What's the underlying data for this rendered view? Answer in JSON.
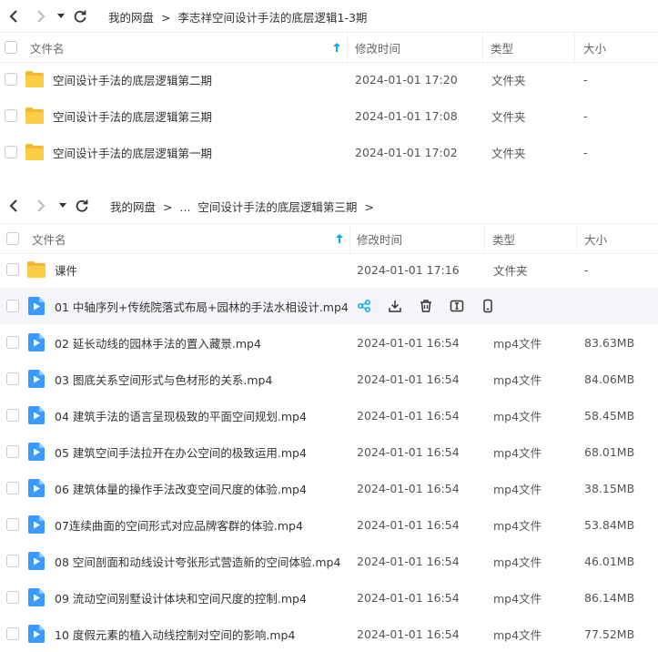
{
  "top": {
    "breadcrumb": [
      "我的网盘",
      "李志祥空间设计手法的底层逻辑1-3期"
    ],
    "headers": {
      "name": "文件名",
      "modified": "修改时间",
      "type": "类型",
      "size": "大小"
    },
    "rows": [
      {
        "name": "空间设计手法的底层逻辑第二期",
        "modified": "2024-01-01 17:20",
        "type": "文件夹",
        "size": "-",
        "icon": "folder-icon"
      },
      {
        "name": "空间设计手法的底层逻辑第三期",
        "modified": "2024-01-01 17:08",
        "type": "文件夹",
        "size": "-",
        "icon": "folder-icon"
      },
      {
        "name": "空间设计手法的底层逻辑第一期",
        "modified": "2024-01-01 17:02",
        "type": "文件夹",
        "size": "-",
        "icon": "folder-icon"
      }
    ]
  },
  "bottom": {
    "breadcrumb": [
      "我的网盘",
      "...",
      "空间设计手法的底层逻辑第三期"
    ],
    "headers": {
      "name": "文件名",
      "modified": "修改时间",
      "type": "类型",
      "size": "大小"
    },
    "rows": [
      {
        "name": "课件",
        "modified": "2024-01-01 17:16",
        "type": "文件夹",
        "size": "-",
        "icon": "folder-icon"
      },
      {
        "name": "01 中轴序列+传统院落式布局+园林的手法水相设计.mp4",
        "modified": "",
        "type": "",
        "size": "",
        "icon": "video-file-icon",
        "hovered": true
      },
      {
        "name": "02 延长动线的园林手法的置入藏景.mp4",
        "modified": "2024-01-01 16:54",
        "type": "mp4文件",
        "size": "83.63MB",
        "icon": "video-file-icon"
      },
      {
        "name": "03 图底关系空间形式与色材形的关系.mp4",
        "modified": "2024-01-01 16:54",
        "type": "mp4文件",
        "size": "84.06MB",
        "icon": "video-file-icon"
      },
      {
        "name": "04 建筑手法的语言呈现极致的平面空间规划.mp4",
        "modified": "2024-01-01 16:54",
        "type": "mp4文件",
        "size": "58.45MB",
        "icon": "video-file-icon"
      },
      {
        "name": "05 建筑空间手法拉开在办公空间的极致运用.mp4",
        "modified": "2024-01-01 16:54",
        "type": "mp4文件",
        "size": "68.01MB",
        "icon": "video-file-icon"
      },
      {
        "name": "06 建筑体量的操作手法改变空间尺度的体验.mp4",
        "modified": "2024-01-01 16:54",
        "type": "mp4文件",
        "size": "38.15MB",
        "icon": "video-file-icon"
      },
      {
        "name": "07连续曲面的空间形式对应品牌客群的体验.mp4",
        "modified": "2024-01-01 16:54",
        "type": "mp4文件",
        "size": "53.84MB",
        "icon": "video-file-icon"
      },
      {
        "name": "08 空间剖面和动线设计夸张形式营造新的空间体验.mp4",
        "modified": "2024-01-01 16:54",
        "type": "mp4文件",
        "size": "46.01MB",
        "icon": "video-file-icon"
      },
      {
        "name": "09 流动空间别墅设计体块和空间尺度的控制.mp4",
        "modified": "2024-01-01 16:54",
        "type": "mp4文件",
        "size": "86.14MB",
        "icon": "video-file-icon"
      },
      {
        "name": "10 度假元素的植入动线控制对空间的影响.mp4",
        "modified": "2024-01-01 16:54",
        "type": "mp4文件",
        "size": "77.52MB",
        "icon": "video-file-icon"
      }
    ],
    "row_actions": [
      "share-icon",
      "download-icon",
      "delete-icon",
      "rename-icon",
      "mobile-icon"
    ]
  },
  "colors": {
    "accent": "#06a7ff",
    "folder": "#f9c536",
    "video": "#3a9bff"
  }
}
